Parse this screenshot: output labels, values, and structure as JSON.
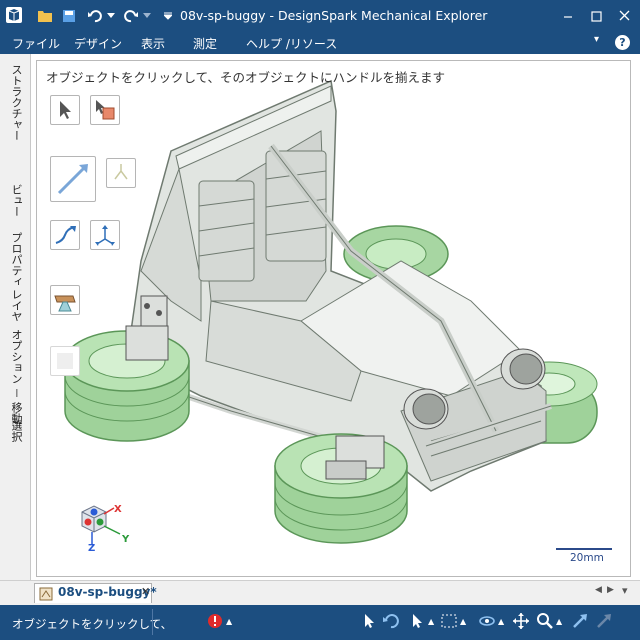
{
  "window": {
    "title": "08v-sp-buggy - DesignSpark Mechanical Explorer"
  },
  "menu": {
    "items": [
      "ファイル",
      "デザイン",
      "表示",
      "測定",
      "ヘルプ /リソース"
    ]
  },
  "side_panel": {
    "tabs": [
      "ストラクチャー",
      "ビュー",
      "プロパティ",
      "レイヤ",
      "オプション － 移動",
      "選択"
    ]
  },
  "viewport": {
    "hint": "オブジェクトをクリックして、そのオブジェクトにハンドルを揃えます",
    "scale_label": "20mm",
    "axes": {
      "x": "X",
      "y": "Y",
      "z": "Z"
    }
  },
  "document": {
    "tab_label": "08v-sp-buggy*"
  },
  "status": {
    "text": "オブジェクトをクリックして、"
  },
  "colors": {
    "chrome": "#1c4e80",
    "tire": "#9fd29a",
    "body": "#e1e5e1"
  }
}
